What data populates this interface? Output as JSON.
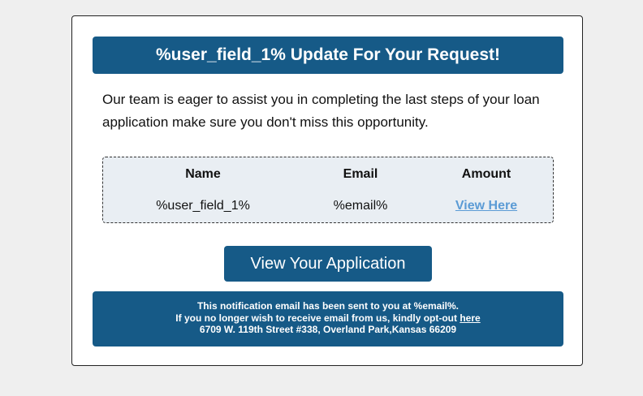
{
  "header": {
    "title": "%user_field_1% Update For Your Request!"
  },
  "intro": {
    "text": "Our team is eager to assist you in completing the last steps of your loan application make sure you don't miss this opportunity."
  },
  "info_table": {
    "headers": [
      "Name",
      "Email",
      "Amount"
    ],
    "row": {
      "name": "%user_field_1%",
      "email": "%email%",
      "amount_link": "View Here"
    }
  },
  "cta": {
    "label": "View Your Application"
  },
  "footer": {
    "line1": "This notification email has been sent to you at %email%.",
    "line2_prefix": "If you no longer wish to receive email from us, kindly opt-out ",
    "line2_link": "here",
    "line3": "6709 W. 119th Street #338, Overland Park,Kansas 66209"
  },
  "colors": {
    "page_background": "#efefef",
    "brand_blue": "#165a87",
    "table_background": "#e9eef3",
    "link_blue": "#5b9bd5"
  }
}
